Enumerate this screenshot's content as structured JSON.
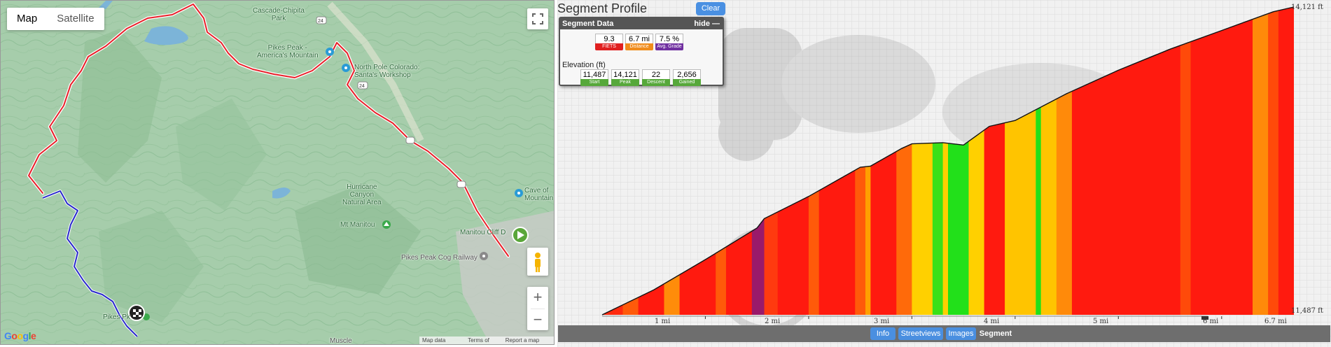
{
  "map": {
    "type_controls": [
      "Map",
      "Satellite"
    ],
    "active_type": "Map",
    "zoom_in": "+",
    "zoom_out": "−",
    "labels": [
      {
        "id": "cascade",
        "text": "Cascade-Chipita\nPark"
      },
      {
        "id": "hwy24a",
        "text": "24"
      },
      {
        "id": "pikespeak-am",
        "text": "Pikes Peak -\nAmerica's Mountain"
      },
      {
        "id": "northpole",
        "text": "North Pole Colorado:\nSanta's Workshop"
      },
      {
        "id": "hwy24b",
        "text": "24"
      },
      {
        "id": "hurricane",
        "text": "Hurricane\nCanyon\nNatural Area"
      },
      {
        "id": "mtmanitou",
        "text": "Mt Manitou"
      },
      {
        "id": "caveofwinds",
        "text": "Cave of\nMountain"
      },
      {
        "id": "manitoucliff",
        "text": "Manitou Cliff D"
      },
      {
        "id": "cograilway",
        "text": "Pikes Peak Cog Railway"
      },
      {
        "id": "pikespk",
        "text": "Pikes Pk"
      },
      {
        "id": "muscle",
        "text": "Muscle"
      }
    ],
    "google_logo": "Google",
    "attribution": [
      "Map data ©2020",
      "Terms of Use",
      "Report a map error"
    ]
  },
  "profile": {
    "title": "Segment Profile",
    "clear_label": "Clear",
    "ymax_label": "14,121 ft",
    "ymin_label": "11,487 ft",
    "segment_data": {
      "header": "Segment Data",
      "hide_label": "hide —",
      "fiets": {
        "value": "9.3",
        "key": "FIETS",
        "color": "#e02020"
      },
      "distance": {
        "value": "6.7 mi",
        "key": "Distance",
        "color": "#f08c1c"
      },
      "avg_grade": {
        "value": "7.5 %",
        "key": "Avg. Grade",
        "color": "#7030a0"
      },
      "elevation_label": "Elevation (ft)",
      "start": {
        "value": "11,487",
        "key": "Start",
        "color": "#56a83a"
      },
      "peak": {
        "value": "14,121",
        "key": "Peak",
        "color": "#56a83a"
      },
      "descent": {
        "value": "22",
        "key": "Descent",
        "color": "#56a83a"
      },
      "gained": {
        "value": "2,656",
        "key": "Gained",
        "color": "#56a83a"
      }
    },
    "x_ticks": [
      "1 mi",
      "2 mi",
      "3 mi",
      "4 mi",
      "5 mi",
      "6 mi",
      "6.7 mi"
    ],
    "bottom_buttons": [
      {
        "id": "info",
        "label": "Info"
      },
      {
        "id": "streetviews",
        "label": "Streetviews"
      },
      {
        "id": "images",
        "label": "Images"
      },
      {
        "id": "segment",
        "label": "Segment"
      }
    ]
  },
  "chart_data": {
    "type": "area",
    "x_unit": "mi",
    "y_unit": "ft",
    "xlim": [
      0,
      6.7
    ],
    "ylim": [
      11487,
      14121
    ],
    "x": [
      0,
      0.5,
      1.0,
      1.5,
      1.57,
      2.0,
      2.5,
      2.6,
      2.9,
      3.0,
      3.3,
      3.5,
      3.75,
      4.0,
      4.5,
      5.0,
      5.5,
      6.0,
      6.5,
      6.7
    ],
    "y": [
      11487,
      11700,
      11960,
      12230,
      12310,
      12500,
      12750,
      12760,
      12910,
      12950,
      12960,
      12940,
      13100,
      13150,
      13380,
      13580,
      13760,
      13920,
      14080,
      14121
    ],
    "grade_colors": {
      "low": "#22e01a",
      "mid": "#ffd500",
      "high": "#ff1a0f",
      "steep": "#8b1a6b"
    },
    "grade_bands": [
      {
        "x0": 0.0,
        "x1": 0.2,
        "c": "#ff2a0f"
      },
      {
        "x0": 0.2,
        "x1": 0.35,
        "c": "#ff5a0a"
      },
      {
        "x0": 0.35,
        "x1": 0.6,
        "c": "#ff1a0f"
      },
      {
        "x0": 0.6,
        "x1": 0.75,
        "c": "#ff8c0a"
      },
      {
        "x0": 0.75,
        "x1": 1.1,
        "c": "#ff1a0f"
      },
      {
        "x0": 1.1,
        "x1": 1.2,
        "c": "#ff5a0a"
      },
      {
        "x0": 1.2,
        "x1": 1.45,
        "c": "#ff1a0f"
      },
      {
        "x0": 1.45,
        "x1": 1.57,
        "c": "#9a1a6a"
      },
      {
        "x0": 1.57,
        "x1": 1.7,
        "c": "#ff3a0f"
      },
      {
        "x0": 1.7,
        "x1": 2.0,
        "c": "#ff1a0f"
      },
      {
        "x0": 2.0,
        "x1": 2.1,
        "c": "#ff5a0a"
      },
      {
        "x0": 2.1,
        "x1": 2.45,
        "c": "#ff1a0f"
      },
      {
        "x0": 2.45,
        "x1": 2.55,
        "c": "#ff5a0a"
      },
      {
        "x0": 2.55,
        "x1": 2.6,
        "c": "#ffa000"
      },
      {
        "x0": 2.6,
        "x1": 2.85,
        "c": "#ff1a0f"
      },
      {
        "x0": 2.85,
        "x1": 3.0,
        "c": "#ff6a0a"
      },
      {
        "x0": 3.0,
        "x1": 3.2,
        "c": "#ffd000"
      },
      {
        "x0": 3.2,
        "x1": 3.3,
        "c": "#3ae018"
      },
      {
        "x0": 3.3,
        "x1": 3.35,
        "c": "#ffd000"
      },
      {
        "x0": 3.35,
        "x1": 3.55,
        "c": "#22e01a"
      },
      {
        "x0": 3.55,
        "x1": 3.7,
        "c": "#ffd000"
      },
      {
        "x0": 3.7,
        "x1": 3.9,
        "c": "#ff1a0f"
      },
      {
        "x0": 3.9,
        "x1": 4.2,
        "c": "#ffc400"
      },
      {
        "x0": 4.2,
        "x1": 4.25,
        "c": "#22e01a"
      },
      {
        "x0": 4.25,
        "x1": 4.4,
        "c": "#ffc400"
      },
      {
        "x0": 4.4,
        "x1": 4.55,
        "c": "#ff8a0a"
      },
      {
        "x0": 4.55,
        "x1": 5.6,
        "c": "#ff1a0f"
      },
      {
        "x0": 5.6,
        "x1": 5.7,
        "c": "#ff4a0a"
      },
      {
        "x0": 5.7,
        "x1": 6.3,
        "c": "#ff1a0f"
      },
      {
        "x0": 6.3,
        "x1": 6.45,
        "c": "#ff8a0a"
      },
      {
        "x0": 6.45,
        "x1": 6.55,
        "c": "#ff4a0a"
      },
      {
        "x0": 6.55,
        "x1": 6.7,
        "c": "#ff1a0f"
      }
    ]
  }
}
